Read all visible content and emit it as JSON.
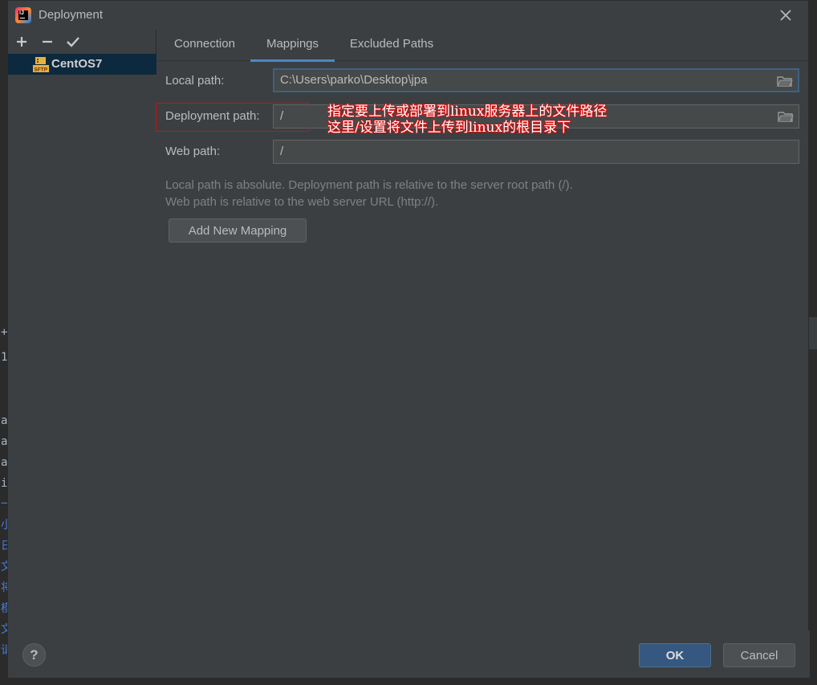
{
  "window": {
    "title": "Deployment",
    "app_icon_label": "IJ"
  },
  "background_editor": {
    "chars": [
      "+",
      "1",
      "a",
      "a",
      "a",
      "i",
      "一",
      "小",
      "日",
      "文",
      "将",
      "模",
      "文",
      "请"
    ]
  },
  "sidebar": {
    "toolbar": {
      "add": "+",
      "remove": "−",
      "apply": "✔"
    },
    "servers": [
      {
        "name": "CentOS7",
        "icon": "sftp-server-icon",
        "icon_label": "SFTP",
        "selected": true
      }
    ]
  },
  "tabs": [
    {
      "label": "Connection",
      "active": false
    },
    {
      "label": "Mappings",
      "active": true
    },
    {
      "label": "Excluded Paths",
      "active": false
    }
  ],
  "mapping": {
    "local_path_label": "Local path:",
    "local_path_value": "C:\\Users\\parko\\Desktop\\jpa",
    "deployment_path_label": "Deployment path:",
    "deployment_path_value": "/",
    "web_path_label": "Web path:",
    "web_path_value": "/"
  },
  "annotation": {
    "line1": "指定要上传或部署到linux服务器上的文件路径",
    "line2": "这里/设置将文件上传到linux的根目录下",
    "color": "#d01010"
  },
  "help": {
    "line1": "Local path is absolute. Deployment path is relative to the server root path (/).",
    "line2": "Web path is relative to the web server URL (http://)."
  },
  "buttons": {
    "add_mapping": "Add New Mapping",
    "help": "?",
    "ok": "OK",
    "cancel": "Cancel"
  },
  "colors": {
    "accent": "#4a88c7",
    "selection": "#0d293e",
    "ok_button": "#365880"
  }
}
